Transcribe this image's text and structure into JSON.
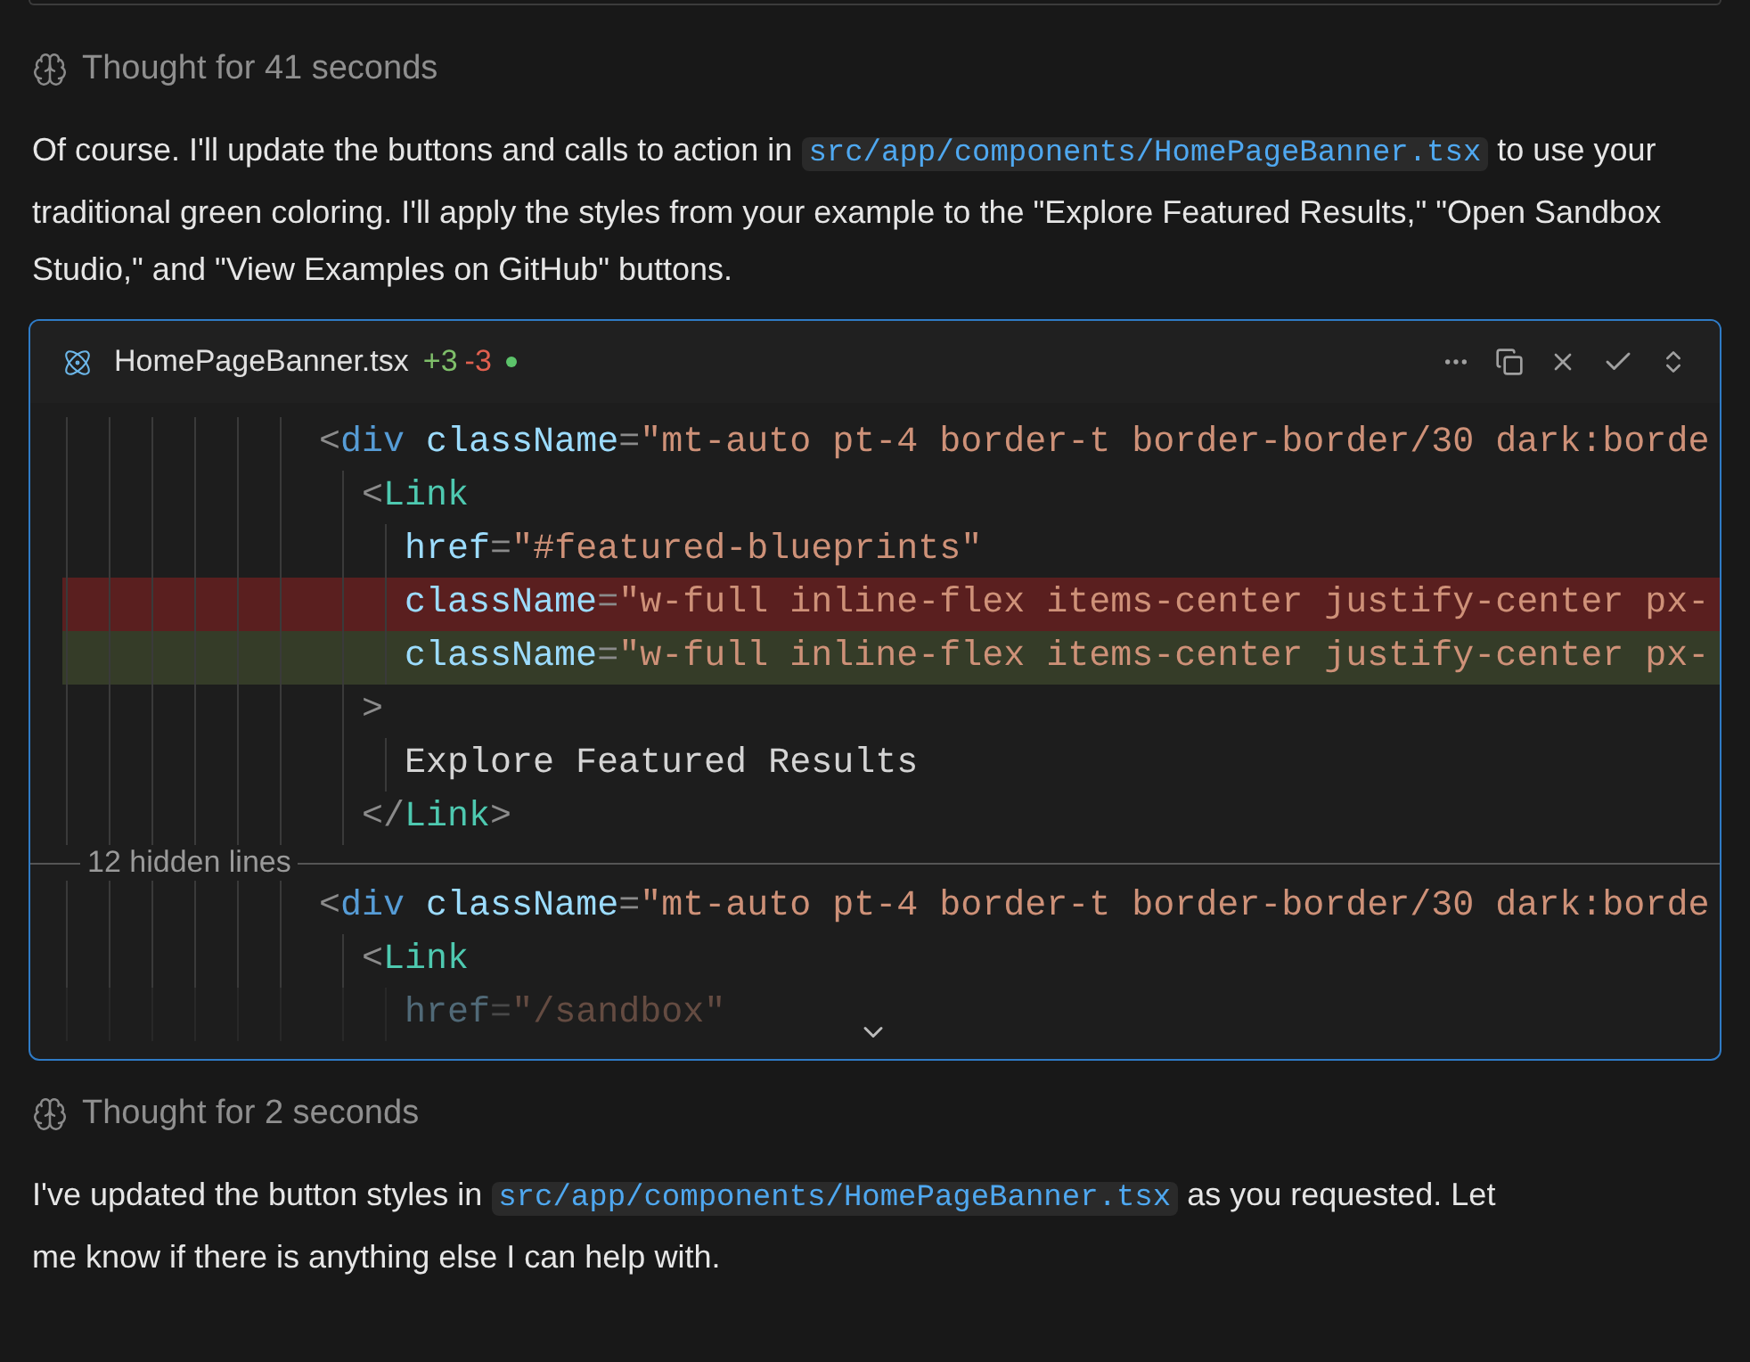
{
  "thoughts": [
    {
      "label": "Thought for 41 seconds"
    },
    {
      "label": "Thought for 2 seconds"
    }
  ],
  "messages": [
    {
      "segments": [
        {
          "kind": "text",
          "text": "Of course. I'll update the buttons and calls to action in "
        },
        {
          "kind": "code",
          "text": "src/app/components/HomePageBanner.tsx"
        },
        {
          "kind": "text",
          "text": " to use your traditional green coloring. I'll apply the styles from your example to the \"Explore Featured Results,\" \"Open Sandbox Studio,\" and \"View Examples on GitHub\" buttons."
        }
      ]
    },
    {
      "segments": [
        {
          "kind": "text",
          "text": "I've updated the button styles in "
        },
        {
          "kind": "code",
          "text": "src/app/components/HomePageBanner.tsx"
        },
        {
          "kind": "text",
          "text": " as you requested. Let me know if there is anything else I can help with."
        }
      ]
    }
  ],
  "diff_card": {
    "file_name": "HomePageBanner.tsx",
    "added": "+3",
    "removed": "-3",
    "unsaved": true,
    "lines": [
      {
        "kind": "context",
        "tokens": [
          {
            "kind": "punct",
            "text": "            <"
          },
          {
            "kind": "tag",
            "text": "div"
          },
          {
            "kind": "attr",
            "text": " className"
          },
          {
            "kind": "punct",
            "text": "="
          },
          {
            "kind": "string",
            "text": "\"mt-auto pt-4 border-t border-border/30 dark:borde"
          }
        ]
      },
      {
        "kind": "context",
        "tokens": [
          {
            "kind": "punct",
            "text": "              <"
          },
          {
            "kind": "component",
            "text": "Link"
          }
        ]
      },
      {
        "kind": "context",
        "tokens": [
          {
            "kind": "attr",
            "text": "                href"
          },
          {
            "kind": "punct",
            "text": "="
          },
          {
            "kind": "string",
            "text": "\"#featured-blueprints\""
          }
        ]
      },
      {
        "kind": "removed",
        "tokens": [
          {
            "kind": "attr",
            "text": "                className"
          },
          {
            "kind": "punct",
            "text": "="
          },
          {
            "kind": "string",
            "text": "\"w-full inline-flex items-center justify-center px-"
          }
        ]
      },
      {
        "kind": "added",
        "tokens": [
          {
            "kind": "attr",
            "text": "                className"
          },
          {
            "kind": "punct",
            "text": "="
          },
          {
            "kind": "string",
            "text": "\"w-full inline-flex items-center justify-center px-"
          }
        ]
      },
      {
        "kind": "context",
        "tokens": [
          {
            "kind": "punct",
            "text": "              >"
          }
        ]
      },
      {
        "kind": "context",
        "tokens": [
          {
            "kind": "text",
            "text": "                Explore Featured Results"
          }
        ]
      },
      {
        "kind": "context",
        "tokens": [
          {
            "kind": "punct",
            "text": "              </"
          },
          {
            "kind": "component",
            "text": "Link"
          },
          {
            "kind": "punct",
            "text": ">"
          }
        ]
      },
      {
        "kind": "separator",
        "label": "12 hidden lines"
      },
      {
        "kind": "context",
        "tokens": [
          {
            "kind": "punct",
            "text": "            <"
          },
          {
            "kind": "tag",
            "text": "div"
          },
          {
            "kind": "attr",
            "text": " className"
          },
          {
            "kind": "punct",
            "text": "="
          },
          {
            "kind": "string",
            "text": "\"mt-auto pt-4 border-t border-border/30 dark:borde"
          }
        ]
      },
      {
        "kind": "context",
        "tokens": [
          {
            "kind": "punct",
            "text": "              <"
          },
          {
            "kind": "component",
            "text": "Link"
          }
        ]
      },
      {
        "kind": "faded",
        "tokens": [
          {
            "kind": "attr",
            "text": "                href"
          },
          {
            "kind": "punct",
            "text": "="
          },
          {
            "kind": "string",
            "text": "\"/sandbox\""
          }
        ]
      }
    ]
  }
}
